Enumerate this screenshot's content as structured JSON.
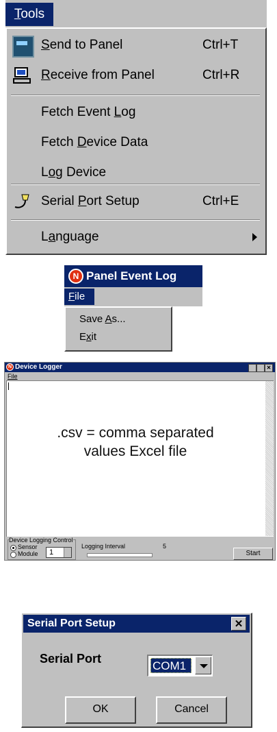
{
  "tools_menu": {
    "title_rest": "ools",
    "title_underlined": "T",
    "items": [
      {
        "pre": "",
        "ul": "S",
        "post": "end to Panel",
        "shortcut": "Ctrl+T",
        "icon": "panel-icon"
      },
      {
        "pre": "",
        "ul": "R",
        "post": "eceive from Panel",
        "shortcut": "Ctrl+R",
        "icon": "computer-icon"
      },
      {
        "pre": "Fetch Event ",
        "ul": "L",
        "post": "og",
        "shortcut": ""
      },
      {
        "pre": "Fetch ",
        "ul": "D",
        "post": "evice Data",
        "shortcut": ""
      },
      {
        "pre": "L",
        "ul": "o",
        "post": "g Device",
        "shortcut": ""
      },
      {
        "pre": "Serial ",
        "ul": "P",
        "post": "ort Setup",
        "shortcut": "Ctrl+E",
        "icon": "serial-cable-icon"
      },
      {
        "pre": "L",
        "ul": "a",
        "post": "nguage",
        "shortcut": ""
      }
    ]
  },
  "panel_event_log": {
    "title": "Panel Event Log",
    "logo_letter": "N",
    "menu_file_ul": "F",
    "menu_file_rest": "ile",
    "save_as_pre": "Save ",
    "save_as_ul": "A",
    "save_as_post": "s...",
    "exit_pre": "E",
    "exit_ul": "x",
    "exit_post": "it"
  },
  "device_logger": {
    "title": "Device Logger",
    "menu_file": "File",
    "caption_line1": ".csv = comma separated",
    "caption_line2": "values Excel file",
    "group_label": "Device Logging Control",
    "radio_sensor": "Sensor",
    "radio_module": "Module",
    "spin_value": "1",
    "interval_label": "Logging Interval",
    "interval_value": "5",
    "start_label": "Start"
  },
  "serial_port_setup": {
    "title": "Serial Port Setup",
    "close_label": "✕",
    "label": "Serial Port",
    "selected_port": "COM1",
    "ok_label": "OK",
    "cancel_label": "Cancel"
  }
}
